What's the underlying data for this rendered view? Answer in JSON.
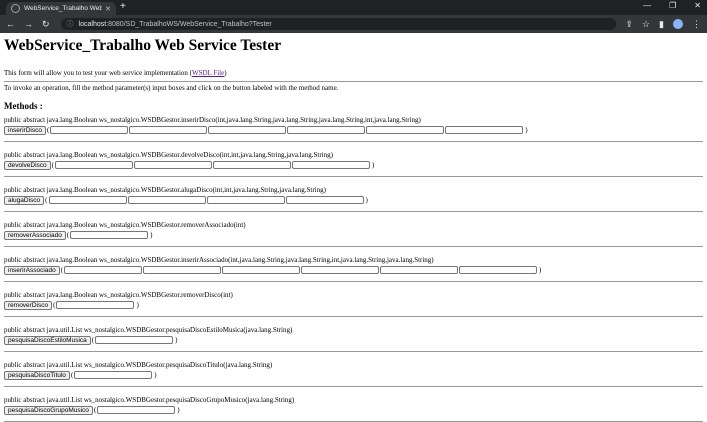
{
  "browser": {
    "tab_title": "WebService_Trabalho Web Servic",
    "new_tab": "+",
    "url_host": "localhost",
    "url_path": ":8080/SD_TrabalhoWS/WebService_Trabalho?Tester",
    "window_controls": [
      "—",
      "❐",
      "✕"
    ]
  },
  "page": {
    "title": "WebService_Trabalho Web Service Tester",
    "intro_text": "This form will allow you to test your web service implementation (",
    "wsdl_link": "WSDL File",
    "intro_end": ")",
    "instructions": "To invoke an operation, fill the method parameter(s) input boxes and click on the button labeled with the method name.",
    "methods_heading": "Methods :"
  },
  "methods": [
    {
      "signature": "public abstract java.lang.Boolean ws_nostalgico.WSDBGestor.inserirDisco(int,java.lang.String,java.lang.String,java.lang.String,int,java.lang.String)",
      "button": "inserirDisco",
      "inputs": 6
    },
    {
      "signature": "public abstract java.lang.Boolean ws_nostalgico.WSDBGestor.devolveDisco(int,int,java.lang.String,java.lang.String)",
      "button": "devolveDisco",
      "inputs": 4
    },
    {
      "signature": "public abstract java.lang.Boolean ws_nostalgico.WSDBGestor.alugaDisco(int,int,java.lang.String,java.lang.String)",
      "button": "alugaDisco",
      "inputs": 4
    },
    {
      "signature": "public abstract java.lang.Boolean ws_nostalgico.WSDBGestor.removerAssociado(int)",
      "button": "removerAssociado",
      "inputs": 1
    },
    {
      "signature": "public abstract java.lang.Boolean ws_nostalgico.WSDBGestor.inserirAssociado(int,java.lang.String,java.lang.String,int,java.lang.String,java.lang.String)",
      "button": "inserirAssociado",
      "inputs": 6
    },
    {
      "signature": "public abstract java.lang.Boolean ws_nostalgico.WSDBGestor.removerDisco(int)",
      "button": "removerDisco",
      "inputs": 1
    },
    {
      "signature": "public abstract java.util.List ws_nostalgico.WSDBGestor.pesquisaDiscoEstiloMusica(java.lang.String)",
      "button": "pesquisaDiscoEstiloMusica",
      "inputs": 1
    },
    {
      "signature": "public abstract java.util.List ws_nostalgico.WSDBGestor.pesquisaDiscoTitulo(java.lang.String)",
      "button": "pesquisaDiscoTitulo",
      "inputs": 1
    },
    {
      "signature": "public abstract java.util.List ws_nostalgico.WSDBGestor.pesquisaDiscoGrupoMusico(java.lang.String)",
      "button": "pesquisaDiscoGrupoMusico",
      "inputs": 1
    }
  ]
}
